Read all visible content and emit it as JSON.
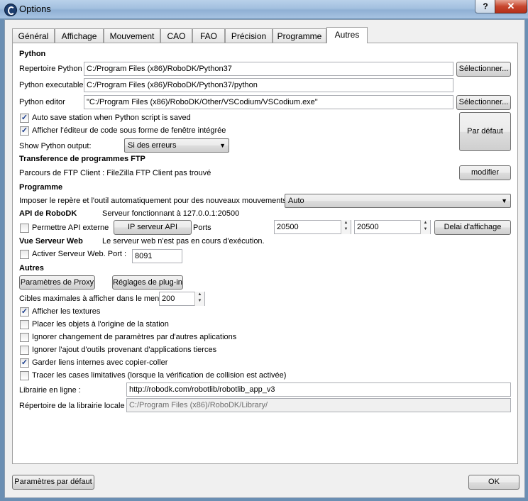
{
  "window": {
    "title": "Options",
    "help_label": "?",
    "close_label": "✕"
  },
  "tabs": [
    "Général",
    "Affichage",
    "Mouvement",
    "CAO",
    "FAO",
    "Précision",
    "Programme",
    "Autres"
  ],
  "python": {
    "section": "Python",
    "dir_label": "Repertoire Python",
    "dir_value": "C:/Program Files (x86)/RoboDK/Python37",
    "exe_label": "Python executable",
    "exe_value": "C:/Program Files (x86)/RoboDK/Python37/python",
    "editor_label": "Python editor",
    "editor_value": "\"C:/Program Files (x86)/RoboDK/Other/VSCodium/VSCodium.exe\"",
    "select_label": "Sélectionner...",
    "autosave_label": "Auto save station when Python script is saved",
    "autosave_checked": true,
    "embedded_label": "Afficher l'éditeur de code sous forme de fenêtre intégrée",
    "embedded_checked": true,
    "default_button": "Par défaut",
    "output_label": "Show Python output:",
    "output_value": "Si des erreurs"
  },
  "ftp": {
    "section": "Transference de programmes FTP",
    "status": "Parcours de FTP Client : FileZilla FTP Client pas trouvé",
    "modify_button": "modifier"
  },
  "programme": {
    "section": "Programme",
    "impose_label": "Imposer le repère et l'outil automatiquement pour des nouveaux mouvements",
    "impose_value": "Auto"
  },
  "api": {
    "section": "API de RoboDK",
    "status": "Serveur fonctionnant à 127.0.0.1:20500",
    "external_label": "Permettre API externe",
    "external_checked": false,
    "ip_button": "IP serveur API",
    "ports_label": "Ports",
    "port1": "20500",
    "port2": "20500",
    "delay_button": "Delai d'affichage"
  },
  "web": {
    "section": "Vue Serveur Web",
    "status": "Le serveur web n'est pas en cours d'exécution.",
    "activate_label": "Activer Serveur Web. Port :",
    "activate_checked": false,
    "port": "8091"
  },
  "autres": {
    "section": "Autres",
    "proxy_button": "Paramètres de Proxy",
    "plugin_button": "Réglages de plug-in",
    "targets_label": "Cibles maximales à afficher dans le menu",
    "targets_value": "200",
    "checkboxes": [
      {
        "label": "Afficher les textures",
        "checked": true
      },
      {
        "label": "Placer les objets à l'origine de la station",
        "checked": false
      },
      {
        "label": "Ignorer changement de paramètres par d'autres aplications",
        "checked": false
      },
      {
        "label": "Ignorer l'ajout d'outils provenant d'applications tierces",
        "checked": false
      },
      {
        "label": "Garder liens internes avec copier-coller",
        "checked": true
      },
      {
        "label": "Tracer les cases limitatives (lorsque la vérification de collision est activée)",
        "checked": false
      }
    ],
    "library_label": "Librairie en ligne :",
    "library_value": "http://robodk.com/robotlib/robotlib_app_v3",
    "local_label": "Répertoire de la librairie locale :",
    "local_value": "C:/Program Files (x86)/RoboDK/Library/"
  },
  "footer": {
    "defaults_button": "Paramètres par défaut",
    "ok_button": "OK"
  },
  "colors": {
    "title_bar": "#a9c4e3",
    "close_button": "#c7462e",
    "check_mark": "#1c3f8f"
  }
}
